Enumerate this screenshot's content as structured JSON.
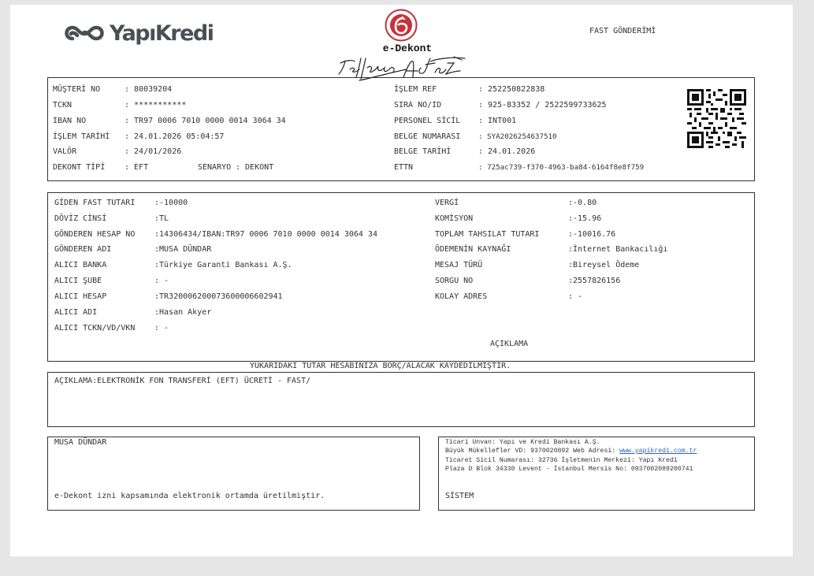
{
  "brand": {
    "name": "YapıKredi"
  },
  "header": {
    "title": "e-Dekont",
    "doc_type": "FAST GÖNDERİMİ"
  },
  "customer_info": {
    "musteri_no": {
      "label": "MÜŞTERİ NO",
      "value": ": 80039204"
    },
    "tckn": {
      "label": "TCKN",
      "value": ": ***********"
    },
    "iban": {
      "label": "IBAN NO",
      "value": ": TR97 0006 7010 0000 0014 3064 34"
    },
    "islem_tarihi": {
      "label": "İŞLEM TARİHİ",
      "value": ": 24.01.2026 05:04:57"
    },
    "valor": {
      "label": "VALÖR",
      "value": ": 24/01/2026"
    },
    "dekont_tipi": {
      "label": "DEKONT TİPİ",
      "value": ": EFT"
    },
    "senaryo": {
      "label": "SENARYO",
      "value": ": DEKONT"
    },
    "islem_ref": {
      "label": "İŞLEM REF",
      "value": ": 252250822838"
    },
    "sira_no": {
      "label": "SIRA NO/ID",
      "value": ": 925-83352 / 2522599733625"
    },
    "personel_sicil": {
      "label": "PERSONEL SİCİL",
      "value": ": INT001"
    },
    "belge_numarasi": {
      "label": "BELGE NUMARASI",
      "value": ": SYA2026254637510"
    },
    "belge_tarihi": {
      "label": "BELGE TARİHİ",
      "value": ": 24.01.2026"
    },
    "ettn": {
      "label": "ETTN",
      "value": ": 725ac739-f370-4963-ba84-6164f8e8f759"
    }
  },
  "transfer": {
    "giden_fast_tutari": {
      "label": "GİDEN FAST TUTARI",
      "value": ":-10000"
    },
    "doviz_cinsi": {
      "label": "DÖVİZ CİNSİ",
      "value": ":TL"
    },
    "gonderen_hesap": {
      "label": "GÖNDEREN HESAP NO",
      "value": ":14306434/IBAN:TR97 0006 7010 0000 0014 3064 34"
    },
    "gonderen_adi": {
      "label": "GÖNDEREN ADI",
      "value": ":MUSA DÜNDAR"
    },
    "alici_banka": {
      "label": "ALICI BANKA",
      "value": ":Türkiye Garanti Bankası A.Ş."
    },
    "alici_sube": {
      "label": "ALICI ŞUBE",
      "value": ": -"
    },
    "alici_hesap": {
      "label": "ALICI HESAP",
      "value": ":TR320006200073600006602941"
    },
    "alici_adi": {
      "label": "ALICI ADI",
      "value": ":Hasan Akyer"
    },
    "alici_tckn": {
      "label": "ALICI TCKN/VD/VKN",
      "value": ": -"
    },
    "vergi": {
      "label": "VERGİ",
      "value": ":-0.80"
    },
    "komisyon": {
      "label": "KOMİSYON",
      "value": ":-15.96"
    },
    "toplam_tahsilat": {
      "label": "TOPLAM TAHSILAT TUTARI",
      "value": ":-10016.76"
    },
    "odemenin_kaynagi": {
      "label": "ÖDEMENİN KAYNAĞI",
      "value": ":İnternet Bankacılığı"
    },
    "mesaj_turu": {
      "label": "MESAJ TÜRÜ",
      "value": ":Bireysel Ödeme"
    },
    "sorgu_no": {
      "label": "SORGU NO",
      "value": ":2557826156"
    },
    "kolay_adres": {
      "label": "KOLAY ADRES",
      "value": ": -"
    },
    "aciklama_heading": "AÇIKLAMA"
  },
  "notice": "YUKARIDAKİ TUTAR HESABINIZA BORÇ/ALACAK KAYDEDİLMİŞTİR.",
  "description": "AÇIKLAMA:ELEKTRONİK FON TRANSFERİ (EFT) ÜCRETİ - FAST/",
  "footer": {
    "customer_name": "MUSA DÜNDAR",
    "edekont_note": "e-Dekont izni kapsamında elektronik ortamda üretilmiştir.",
    "bank_line1": "Ticari Unvan: Yapı ve Kredi Bankası A.Ş.",
    "bank_line2_prefix": "Büyük Mükellefler VD: 9370020892 Web Adresi: ",
    "bank_web": "www.yapikredi.com.tr",
    "bank_line3": "Ticaret Sicil Numarası: 32736 İşletmenin Merkezi: Yapı Kredi",
    "bank_line4": "Plaza D Blok 34330 Levent - İstanbul Mersis No: 0937002089200741",
    "system": "SİSTEM"
  }
}
